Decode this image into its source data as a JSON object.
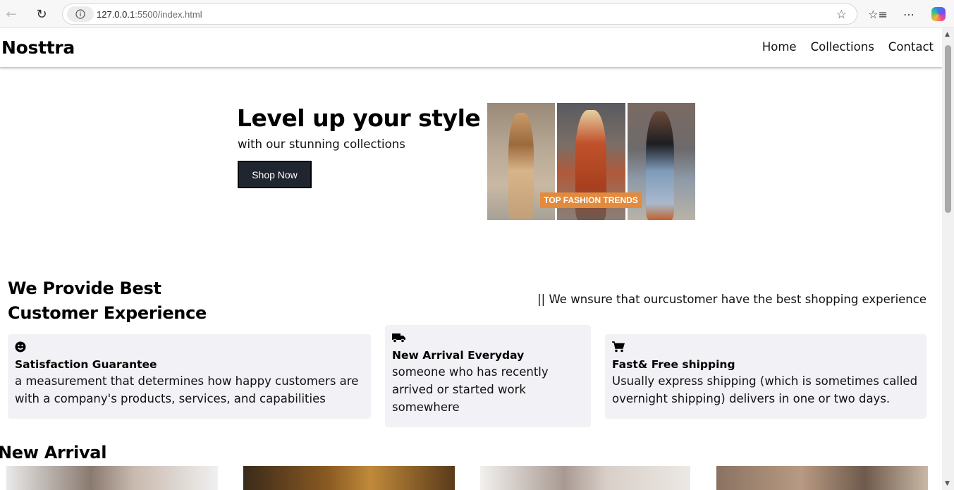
{
  "browser": {
    "url_host": "127.0.0.1",
    "url_rest": ":5500/index.html"
  },
  "site": {
    "logo": "Nosttra",
    "nav": [
      "Home",
      "Collections",
      "Contact"
    ]
  },
  "hero": {
    "title": "Level up your style",
    "subtitle": "with our stunning collections",
    "button": "Shop Now",
    "image_tag": "TOP FASHION TRENDS"
  },
  "features": {
    "title_line1": "We Provide Best",
    "title_line2": "Customer Experience",
    "tagline": "|| We wnsure that ourcustomer have the best shopping experience",
    "cards": [
      {
        "icon": "smiley-icon",
        "title": "Satisfaction Guarantee",
        "text": "a measurement that determines how happy customers are with a company's products, services, and capabilities"
      },
      {
        "icon": "truck-icon",
        "title": "New Arrival Everyday",
        "text": "someone who has recently arrived or started work somewhere"
      },
      {
        "icon": "cart-icon",
        "title": "Fast& Free shipping",
        "text": "Usually express shipping (which is sometimes called overnight shipping) delivers in one or two days."
      }
    ]
  },
  "new_arrival": {
    "title": "New Arrival"
  },
  "colors": {
    "button_bg": "#1f2630",
    "card_bg": "#f2f2f6",
    "tag_bg": "#e38a3c"
  }
}
